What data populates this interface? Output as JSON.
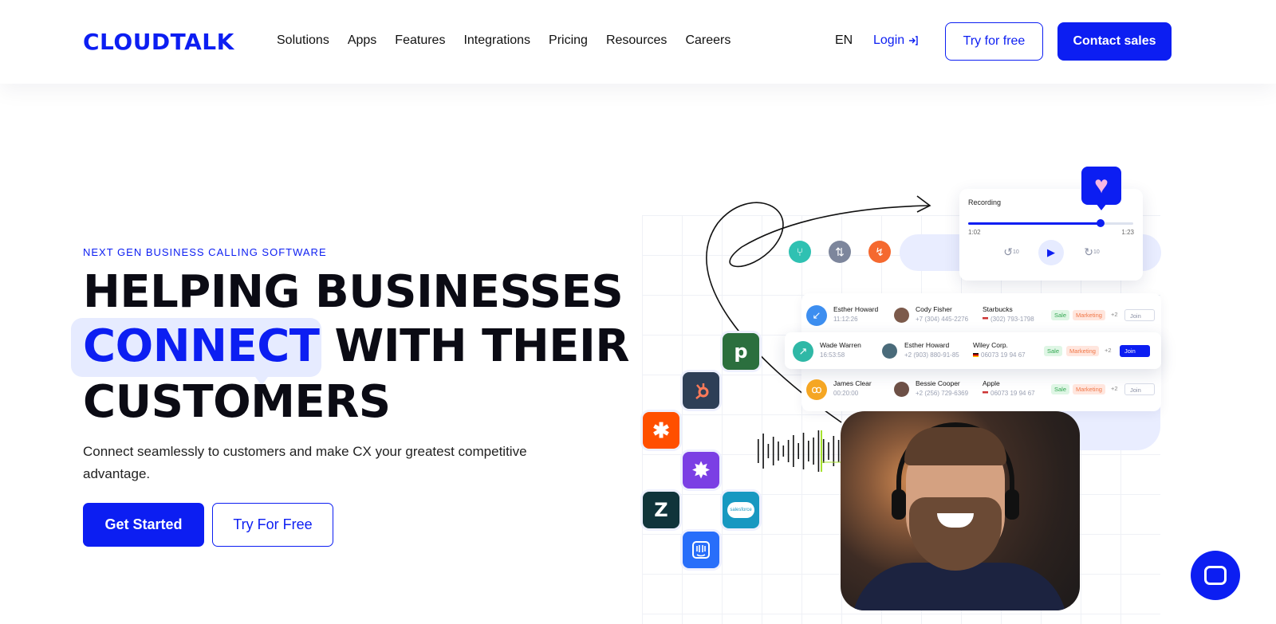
{
  "header": {
    "logo": "CLOUDTALK",
    "nav": [
      "Solutions",
      "Apps",
      "Features",
      "Integrations",
      "Pricing",
      "Resources",
      "Careers"
    ],
    "lang": "EN",
    "login": "Login",
    "try_free": "Try for free",
    "contact_sales": "Contact sales"
  },
  "hero": {
    "eyebrow": "NEXT GEN BUSINESS CALLING SOFTWARE",
    "line1": "HELPING BUSINESSES",
    "connect_word": "CONNECT",
    "line2_rest": " WITH THEIR",
    "line3": "CUSTOMERS",
    "subtitle": "Connect seamlessly to customers and make CX your greatest competitive advantage.",
    "cta_primary": "Get Started",
    "cta_secondary": "Try For Free"
  },
  "recording": {
    "title": "Recording",
    "time_current": "1:02",
    "time_total": "1:23",
    "progress": 0.8,
    "skip_back": "10",
    "skip_fwd": "10"
  },
  "calls": [
    {
      "name": "Esther Howard",
      "time": "11:12:26",
      "contact": "Cody Fisher",
      "contact_phone": "+7 (304) 445-2276",
      "company": "Starbucks",
      "company_phone": "(302) 793-1798",
      "tag1": "Sale",
      "tag2": "Marketing",
      "extra": "+2",
      "join": "Join",
      "icon": "arrow-down-left-icon",
      "icon_color": "#3d8ef0"
    },
    {
      "name": "Wade Warren",
      "time": "16:53:58",
      "contact": "Esther Howard",
      "contact_phone": "+2 (903) 880-91-85",
      "company": "Wiley Corp.",
      "company_phone": "06073 19 94 67",
      "tag1": "Sale",
      "tag2": "Marketing",
      "extra": "+2",
      "join": "Join",
      "icon": "arrow-up-right-icon",
      "icon_color": "#2fb8a6"
    },
    {
      "name": "James Clear",
      "time": "00:20:00",
      "contact": "Bessie Cooper",
      "contact_phone": "+2 (256) 729-6369",
      "company": "Apple",
      "company_phone": "06073 19 94 67",
      "tag1": "Sale",
      "tag2": "Marketing",
      "extra": "+2",
      "join": "Join",
      "icon": "voicemail-icon",
      "icon_color": "#f5a623"
    }
  ],
  "app_icons": {
    "pipedrive": "p",
    "hubspot": "hubspot-icon",
    "zapier": "zapier-icon",
    "shield": "badge-icon",
    "zendesk": "Z",
    "salesforce": "salesforce",
    "intercom": "intercom-icon"
  },
  "colors": {
    "brand": "#0c1ef2",
    "connect_bg": "#e6ebff",
    "sale": "#34a853",
    "marketing": "#f07748"
  }
}
